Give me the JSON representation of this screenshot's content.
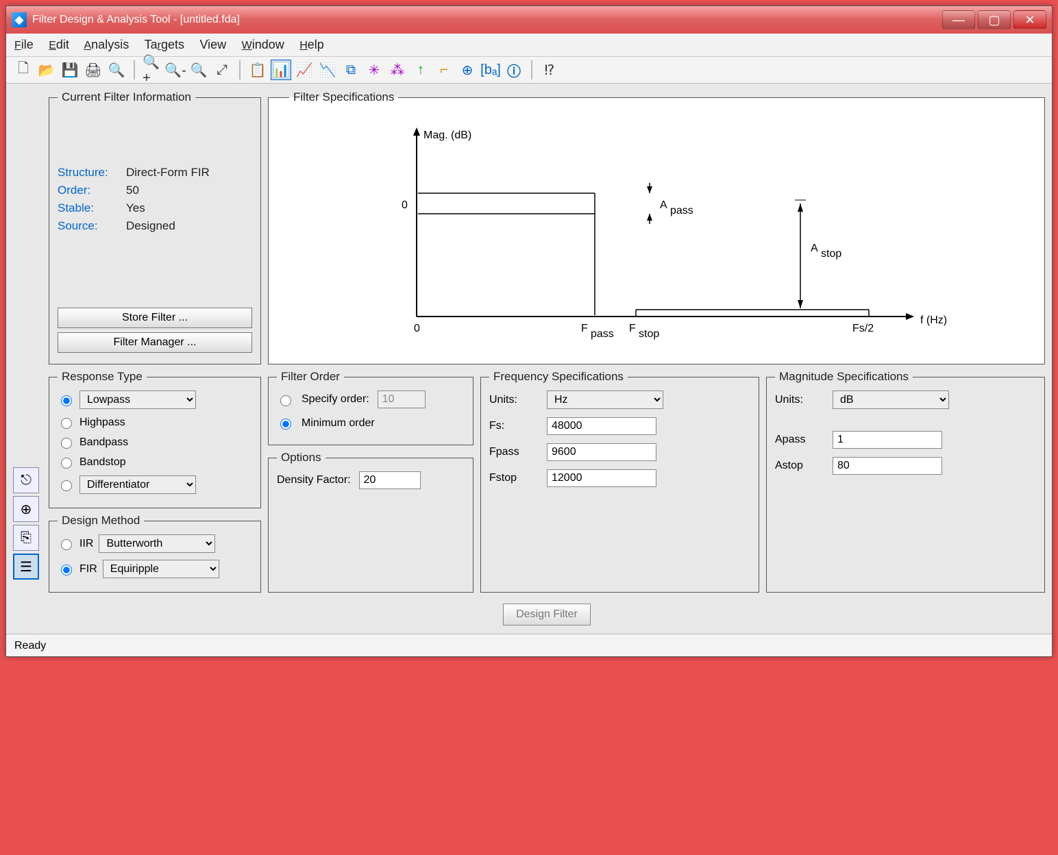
{
  "title": "Filter Design & Analysis Tool - [untitled.fda]",
  "menu": {
    "file": "File",
    "edit": "Edit",
    "analysis": "Analysis",
    "targets": "Targets",
    "view": "View",
    "window": "Window",
    "help": "Help"
  },
  "info": {
    "legend": "Current Filter Information",
    "structure_lab": "Structure:",
    "structure_val": "Direct-Form FIR",
    "order_lab": "Order:",
    "order_val": "50",
    "stable_lab": "Stable:",
    "stable_val": "Yes",
    "source_lab": "Source:",
    "source_val": "Designed",
    "store_btn": "Store Filter ...",
    "manager_btn": "Filter Manager ..."
  },
  "spec": {
    "legend": "Filter Specifications",
    "ylabel": "Mag. (dB)",
    "xlabel": "f (Hz)",
    "zero": "0",
    "fpass": "F",
    "fpass_sub": "pass",
    "fstop": "F",
    "fstop_sub": "stop",
    "fs2": "Fs/2",
    "apass": "A",
    "apass_sub": "pass",
    "astop": "A",
    "astop_sub": "stop"
  },
  "response": {
    "legend": "Response Type",
    "lowpass": "Lowpass",
    "highpass": "Highpass",
    "bandpass": "Bandpass",
    "bandstop": "Bandstop",
    "diff": "Differentiator"
  },
  "method": {
    "legend": "Design Method",
    "iir": "IIR",
    "iir_sel": "Butterworth",
    "fir": "FIR",
    "fir_sel": "Equiripple"
  },
  "order": {
    "legend": "Filter Order",
    "specify": "Specify order:",
    "specify_val": "10",
    "min": "Minimum order"
  },
  "options": {
    "legend": "Options",
    "density": "Density Factor:",
    "density_val": "20"
  },
  "freq": {
    "legend": "Frequency Specifications",
    "units": "Units:",
    "units_val": "Hz",
    "fs": "Fs:",
    "fs_val": "48000",
    "fpass": "Fpass",
    "fpass_val": "9600",
    "fstop": "Fstop",
    "fstop_val": "12000"
  },
  "mag": {
    "legend": "Magnitude Specifications",
    "units": "Units:",
    "units_val": "dB",
    "apass": "Apass",
    "apass_val": "1",
    "astop": "Astop",
    "astop_val": "80"
  },
  "design_btn": "Design Filter",
  "status": "Ready"
}
